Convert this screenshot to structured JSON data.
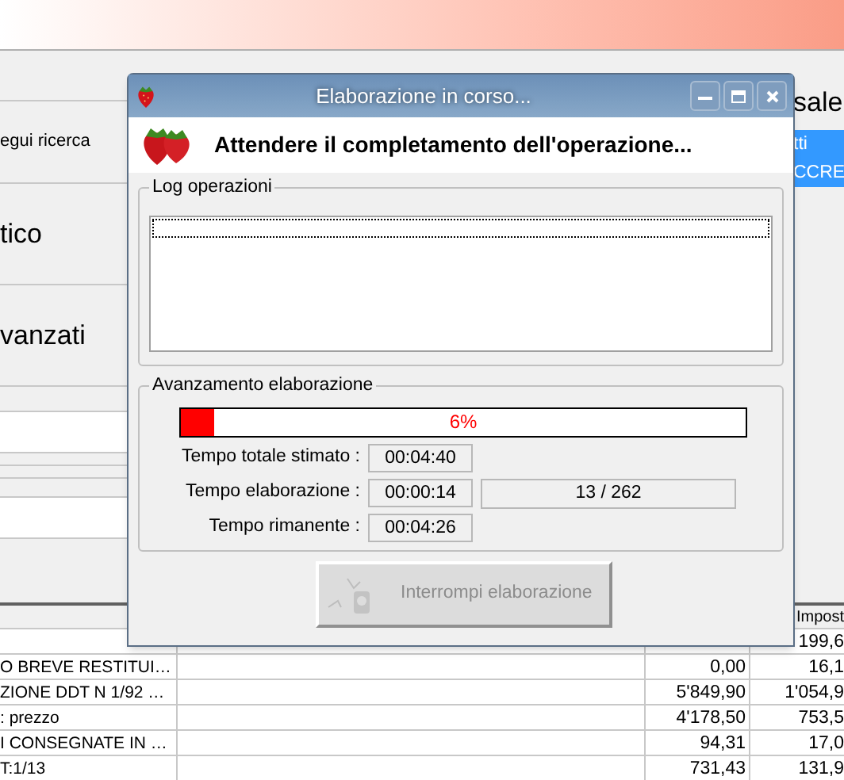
{
  "left_panel": {
    "items": [
      {
        "label": "egui ricerca",
        "kind": "link"
      },
      {
        "label": "tico",
        "kind": "section"
      },
      {
        "label": "vanzati",
        "kind": "section"
      }
    ]
  },
  "right_panel": {
    "header": "sale",
    "selected_lines": [
      "tti",
      "CCRE"
    ]
  },
  "table": {
    "columns": [
      {
        "label": "Impost"
      }
    ],
    "rows": [
      {
        "column_4": "199,6"
      },
      {
        "column_1": "O BREVE RESTITUI…",
        "column_3": "0,00",
        "column_4": "16,1"
      },
      {
        "column_1": "ZIONE DDT N 1/92 …",
        "column_3": "5'849,90",
        "column_4": "1'054,9"
      },
      {
        "column_1": ": prezzo",
        "column_3": "4'178,50",
        "column_4": "753,5"
      },
      {
        "column_1": "I CONSEGNATE IN …",
        "column_3": "94,31",
        "column_4": "17,0"
      },
      {
        "column_1": "T:1/13",
        "column_3": "731,43",
        "column_4": "131,9"
      }
    ]
  },
  "dialog": {
    "title": "Elaborazione in corso...",
    "heading": "Attendere il completamento dell'operazione...",
    "log_group": {
      "label": "Log operazioni"
    },
    "progress_group": {
      "label": "Avanzamento elaborazione",
      "level": 0.06,
      "percent_text": "6%",
      "times": [
        {
          "label": "Tempo totale stimato :",
          "value": "00:04:40"
        },
        {
          "label": "Tempo elaborazione :",
          "value": "00:00:14"
        },
        {
          "label": "Tempo rimanente :",
          "value": "00:04:26"
        }
      ],
      "counter": "13 / 262"
    },
    "button": {
      "label": "Interrompi elaborazione",
      "disabled": true
    }
  }
}
